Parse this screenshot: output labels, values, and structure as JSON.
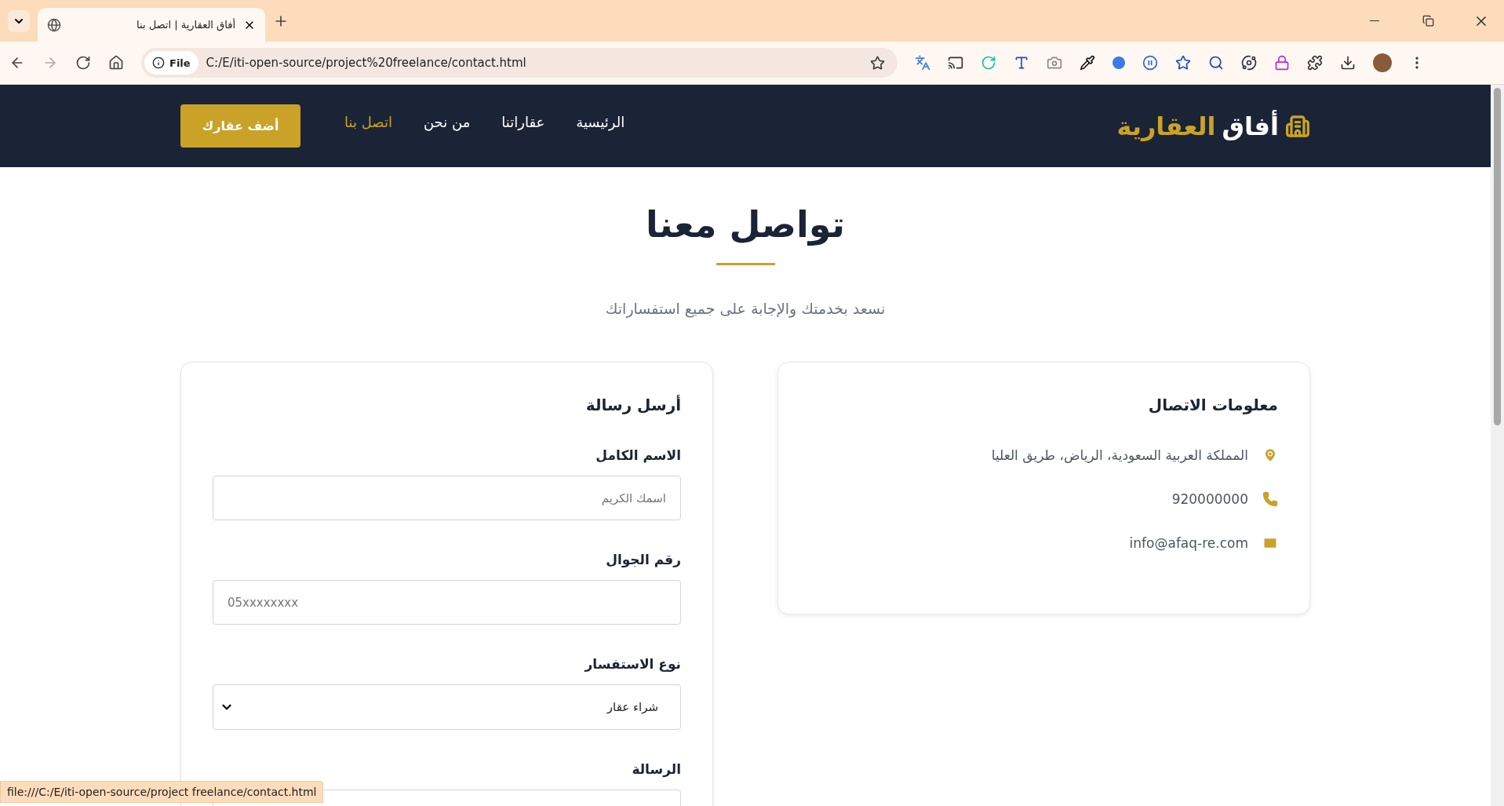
{
  "browser": {
    "tab_title": "أفاق العقارية | اتصل بنا",
    "url_badge": "File",
    "url": "C:/E/iti-open-source/project%20freelance/contact.html",
    "status_url": "file:///C:/E/iti-open-source/project freelance/contact.html"
  },
  "nav": {
    "logo_main": "أفاق",
    "logo_accent": "العقارية",
    "links": [
      {
        "label": "الرئيسية",
        "selected": false
      },
      {
        "label": "عقاراتنا",
        "selected": false
      },
      {
        "label": "من نحن",
        "selected": false
      },
      {
        "label": "اتصل بنا",
        "selected": true
      }
    ],
    "cta": "أضف عقارك"
  },
  "header": {
    "title": "تواصل معنا",
    "subtitle": "نسعد بخدمتك والإجابة على جميع استفساراتك"
  },
  "contact_info": {
    "title": "معلومات الاتصال",
    "items": [
      {
        "kind": "address",
        "text": "المملكة العربية السعودية، الرياض، طريق العليا"
      },
      {
        "kind": "phone",
        "text": "920000000"
      },
      {
        "kind": "email",
        "text": "info@afaq-re.com"
      }
    ]
  },
  "form": {
    "title": "أرسل رسالة",
    "fields": [
      {
        "kind": "text",
        "label": "الاسم الكامل",
        "placeholder": "اسمك الكريم"
      },
      {
        "kind": "tel",
        "label": "رقم الجوال",
        "placeholder": "05xxxxxxxx"
      },
      {
        "kind": "select",
        "label": "نوع الاستفسار",
        "value": "شراء عقار"
      },
      {
        "kind": "textarea",
        "label": "الرسالة"
      }
    ]
  }
}
